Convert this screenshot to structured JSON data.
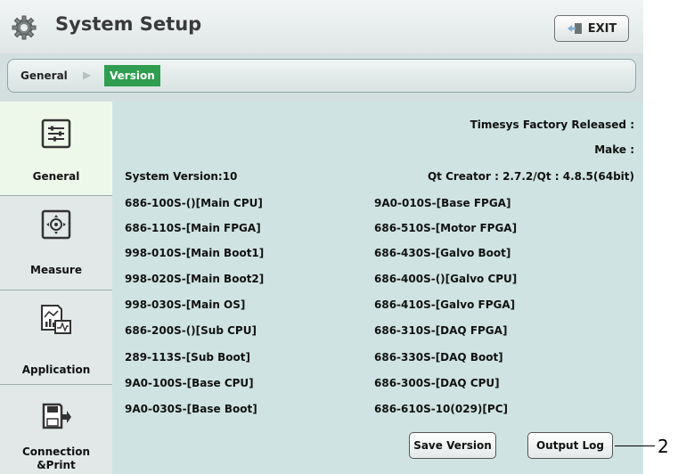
{
  "header": {
    "title": "System Setup",
    "exit_label": "EXIT"
  },
  "breadcrumb": {
    "items": [
      "General",
      "Version"
    ]
  },
  "sidebar": {
    "items": [
      {
        "label": "General",
        "icon": "sliders-icon",
        "active": true
      },
      {
        "label": "Measure",
        "icon": "target-icon",
        "active": false
      },
      {
        "label": "Application",
        "icon": "chart-icon",
        "active": false
      },
      {
        "label": "Connection&Print",
        "icon": "export-icon",
        "active": false
      }
    ]
  },
  "version": {
    "release": "Timesys Factory Released :",
    "make": "Make :",
    "system_version": "System Version:10",
    "qt_creator": "Qt Creator : 2.7.2/Qt : 4.8.5(64bit)",
    "left": [
      "686-100S-()[Main CPU]",
      "686-110S-[Main FPGA]",
      "998-010S-[Main Boot1]",
      "998-020S-[Main Boot2]",
      "998-030S-[Main OS]",
      "686-200S-()[Sub CPU]",
      "289-113S-[Sub Boot]",
      "9A0-100S-[Base CPU]",
      "9A0-030S-[Base Boot]"
    ],
    "right": [
      "9A0-010S-[Base FPGA]",
      "686-510S-[Motor FPGA]",
      "686-430S-[Galvo Boot]",
      "686-400S-()[Galvo CPU]",
      "686-410S-[Galvo FPGA]",
      "686-310S-[DAQ FPGA]",
      "686-330S-[DAQ Boot]",
      "686-300S-[DAQ CPU]",
      "686-610S-10(029)[PC]"
    ]
  },
  "actions": {
    "save_version": "Save Version",
    "output_log": "Output Log"
  },
  "callout": {
    "number": "2"
  },
  "colors": {
    "accent_green": "#2f9e4f",
    "panel": "#cfe4e2"
  }
}
